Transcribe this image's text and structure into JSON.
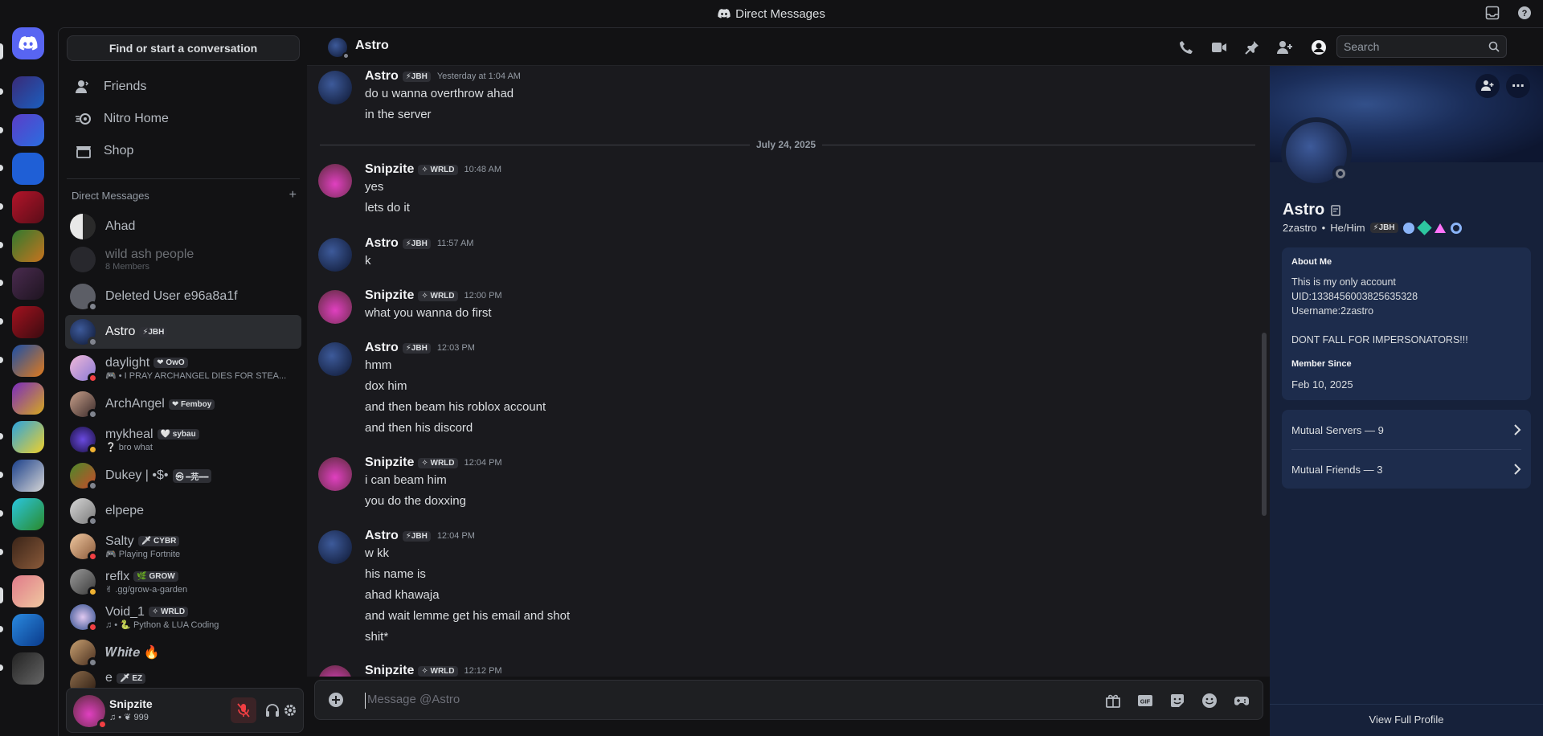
{
  "titlebar": {
    "title": "Direct Messages"
  },
  "sidebar": {
    "find_label": "Find or start a conversation",
    "nav": [
      {
        "label": "Friends"
      },
      {
        "label": "Nitro Home"
      },
      {
        "label": "Shop"
      }
    ],
    "dm_header": "Direct Messages",
    "dms": [
      {
        "name": "Ahad",
        "tag": "",
        "sub": ""
      },
      {
        "name": "wild ash people",
        "tag": "",
        "sub": "8 Members"
      },
      {
        "name": "Deleted User e96a8a1f",
        "tag": "",
        "sub": ""
      },
      {
        "name": "Astro",
        "tag": "⚡JBH",
        "sub": ""
      },
      {
        "name": "daylight",
        "tag": "❤ OwO",
        "sub": "🎮 • I PRAY ARCHANGEL DIES FOR STEA..."
      },
      {
        "name": "ArchAngel",
        "tag": "❤ Femboy",
        "sub": ""
      },
      {
        "name": "mykheal",
        "tag": "🤍 sybau",
        "sub": "❔ bro what"
      },
      {
        "name": "Dukey | •$•",
        "tag": "㉿ ━芫━━",
        "sub": ""
      },
      {
        "name": "elpepe",
        "tag": "",
        "sub": ""
      },
      {
        "name": "Salty",
        "tag": "🗡 CYBR",
        "sub": "🎮 Playing Fortnite"
      },
      {
        "name": "reflx",
        "tag": "🌿 GROW",
        "sub": "✌ .gg/grow-a-garden"
      },
      {
        "name": "Void_1",
        "tag": "✧ WRLD",
        "sub": "♫ • 🐍 Python & LUA Coding"
      },
      {
        "name": "𝑾𝒉𝒊𝒕𝒆 🔥",
        "tag": "",
        "sub": ""
      },
      {
        "name": "e",
        "tag": "🗡 EZ",
        "sub": ""
      }
    ]
  },
  "user": {
    "name": "Snipzite",
    "status": "♫ • ❦ 999"
  },
  "header": {
    "name": "Astro",
    "search_placeholder": "Search"
  },
  "chat": {
    "date_divider": "July 24, 2025",
    "messages": [
      {
        "author": "Astro",
        "tag": "⚡JBH",
        "time": "Yesterday at 1:04 AM",
        "lines": [
          "do u wanna overthrow ahad",
          "in the server"
        ]
      },
      {
        "author": "Snipzite",
        "tag": "✧ WRLD",
        "time": "10:48 AM",
        "lines": [
          "yes",
          "lets do it"
        ]
      },
      {
        "author": "Astro",
        "tag": "⚡JBH",
        "time": "11:57 AM",
        "lines": [
          "k"
        ]
      },
      {
        "author": "Snipzite",
        "tag": "✧ WRLD",
        "time": "12:00 PM",
        "lines": [
          "what you wanna do first"
        ]
      },
      {
        "author": "Astro",
        "tag": "⚡JBH",
        "time": "12:03 PM",
        "lines": [
          "hmm",
          "dox him",
          "and then beam his roblox account",
          "and then his discord"
        ]
      },
      {
        "author": "Snipzite",
        "tag": "✧ WRLD",
        "time": "12:04 PM",
        "lines": [
          "i can beam him",
          "you do the doxxing"
        ]
      },
      {
        "author": "Astro",
        "tag": "⚡JBH",
        "time": "12:04 PM",
        "lines": [
          "w kk",
          "his name is",
          "ahad khawaja",
          "and wait lemme get his email and shot",
          "shit*"
        ]
      },
      {
        "author": "Snipzite",
        "tag": "✧ WRLD",
        "time": "12:12 PM",
        "lines": []
      }
    ]
  },
  "composer": {
    "placeholder": "Message @Astro"
  },
  "profile": {
    "name": "Astro",
    "username": "2zastro",
    "pronouns": "He/Him",
    "tag": "⚡JBH",
    "about_title": "About Me",
    "about_lines": [
      "This is my only account",
      "UID:1338456003825635328",
      "Username:2zastro",
      "",
      "DONT FALL FOR IMPERSONATORS!!!"
    ],
    "member_since_title": "Member Since",
    "member_since": "Feb 10, 2025",
    "mutual_servers": "Mutual Servers — 9",
    "mutual_friends": "Mutual Friends — 3",
    "view_full": "View Full Profile"
  },
  "colors": {
    "accent": "#5865f2",
    "online": "#23a55a",
    "dnd": "#f23f43",
    "idle": "#f0b232",
    "offline": "#80848e"
  }
}
